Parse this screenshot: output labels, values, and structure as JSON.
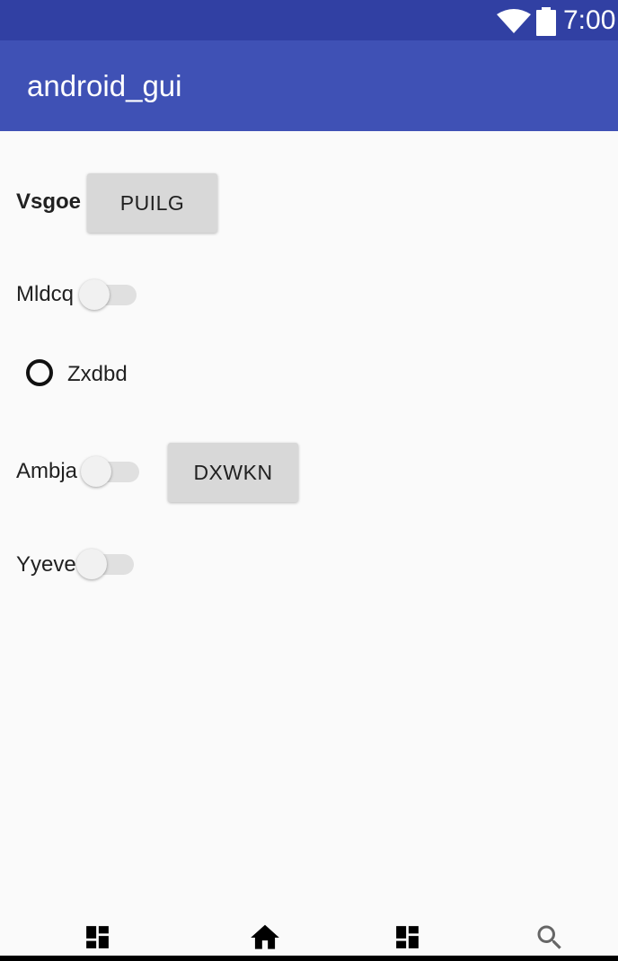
{
  "status_bar": {
    "time": "7:00",
    "wifi_icon": "wifi-icon",
    "battery_icon": "battery-icon",
    "background": "#3140a3"
  },
  "app_bar": {
    "title": "android_gui",
    "background": "#3f51b5"
  },
  "rows": {
    "vsgoe": {
      "label": "Vsgoe",
      "button_label": "PUILG"
    },
    "mldcq": {
      "label": "Mldcq",
      "switch_on": false
    },
    "zxdbd": {
      "label": "Zxdbd",
      "radio_checked": false
    },
    "ambja": {
      "label": "Ambja",
      "switch_on": false,
      "button_label": "DXWKN"
    },
    "yyeve": {
      "label": "Yyeve",
      "switch_on": false
    }
  },
  "bottom_nav": {
    "items": [
      {
        "icon": "dashboard-icon"
      },
      {
        "icon": "home-icon"
      },
      {
        "icon": "dashboard-icon"
      },
      {
        "icon": "search-icon"
      }
    ]
  }
}
